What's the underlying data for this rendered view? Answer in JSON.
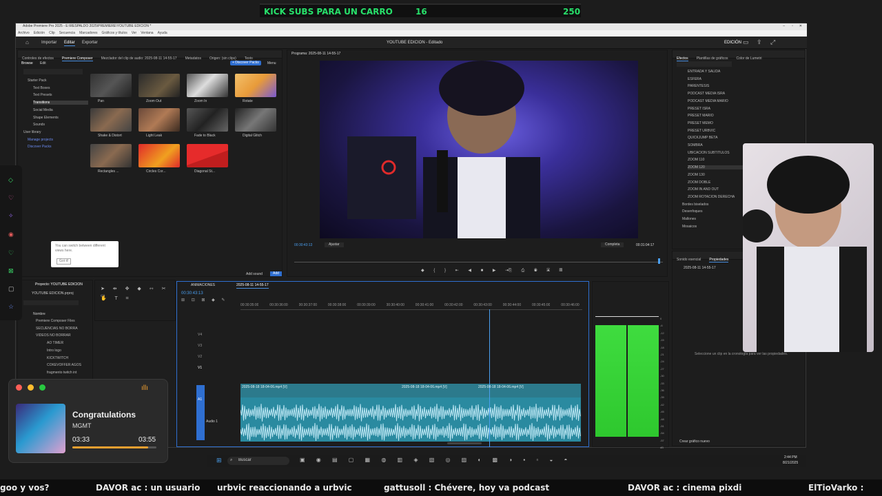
{
  "banner": {
    "text": "KICK SUBS PARA UN CARRO",
    "count": "16",
    "goal": "250"
  },
  "window": {
    "title": "Adobe Premiere Pro 2025 - E:\\RESPALDO 2025\\PREMIERE\\YOUTUBE EDICION *",
    "menu": [
      "Archivo",
      "Edición",
      "Clip",
      "Secuencia",
      "Marcadores",
      "Gráficos y títulos",
      "Ver",
      "Ventana",
      "Ayuda"
    ],
    "nav": {
      "import": "Importar",
      "edit": "Editar",
      "export": "Exportar"
    },
    "project_title": "YOUTUBE EDICION - Editado",
    "workspace": "EDICIÓN"
  },
  "effects_panel": {
    "tabs": [
      "Controles de efectos",
      "Premiere Composer",
      "Mezclador del clip de audio: 2025-08-11 14-55-17",
      "Metadatos",
      "Origen: (sin clips)",
      "Texto"
    ],
    "subtabs": [
      "Browse",
      "Edit"
    ],
    "discover": "+ Discover Packs",
    "menu": "Menu",
    "tree": [
      "Starter Pack",
      "Text Boxes",
      "Text Presets",
      "Transitions",
      "Social Media",
      "Shape Elements",
      "Sounds",
      "User library",
      "Manage projects",
      "Discover Packs"
    ],
    "thumbs": [
      "Pan",
      "Zoom Out",
      "Zoom In",
      "Rotate",
      "Shake & Distort",
      "Light Leak",
      "Fade to Black",
      "Digital Glitch",
      "Rectangles ...",
      "Circles Cor...",
      "Diagonal St..."
    ],
    "tooltip": "You can switch between different views here.",
    "tooltip_btn": "Got it!",
    "add_sound": "Add sound",
    "add": "Add"
  },
  "program": {
    "label": "Programa: 2025-08-11 14-55-17",
    "timecode": "00:30:43:13",
    "fit": "Ajustar",
    "quality": "Completa",
    "duration": "00:31:04:17"
  },
  "right_panel": {
    "tabs": [
      "Efectos",
      "Plantillas de gráficos",
      "Color de Lumetri"
    ],
    "items": [
      "ENTRADA Y SALIDA",
      "ESFERA",
      "PARENTESIS",
      "PODCAST MEDIA ISRA",
      "PODCAST MEDIA MARIO",
      "PRESET ISRA",
      "PRESET MARIO",
      "PRESET MEMO",
      "PRESET URBVIC",
      "QUICKJUMP BETA",
      "SOMBRA",
      "UBICACION SUBTITULOS",
      "ZOOM 110",
      "ZOOM 120",
      "ZOOM 130",
      "ZOOM DOBLE",
      "ZOOM IN AND OUT",
      "ZOOM ROTACION DERECHA",
      "Bordes biselados",
      "Desenfoques",
      "Mallones",
      "Mosaicos"
    ],
    "bottom_tabs": [
      "Sonido esencial",
      "Propiedades"
    ],
    "clip": "2025-08-11 14-55-17",
    "hint": "Seleccione un clip en la cronología para ver las propiedades.",
    "create": "Crear gráfico nuevo"
  },
  "project": {
    "tab": "Proyecto: YOUTUBE EDICION",
    "file": "YOUTUBE EDICION.prproj",
    "col": "Nombre",
    "items": [
      "Premiere Composer Files",
      "SECUENCIAS NO BORRA",
      "VIDEOS NO BORRAR",
      "AO TIMER",
      "Intro logo",
      "KICKTWITCH",
      "COKEVOFFER AGOS",
      "fragmento twitch int"
    ]
  },
  "timeline": {
    "tabs": [
      "ANIMACIONES",
      "2025-08-11 14-55-17"
    ],
    "timecode": "00:30:43:13",
    "ruler": [
      "00:30:35:00",
      "00:30:36:00",
      "00:30:37:00",
      "00:30:38:00",
      "00:30:39:00",
      "00:30:40:00",
      "00:30:41:00",
      "00:30:42:00",
      "00:30:43:00",
      "00:30:44:00",
      "00:30:45:00",
      "00:30:46:00"
    ],
    "tracks": [
      "V4",
      "V3",
      "V2",
      "V1",
      "A1"
    ],
    "audio_label": "Audio 1",
    "clips": [
      "2025-08-18 18-04-06.mp4 [V]",
      "2025-08-18 18-04-06.mp4 [V]",
      "2025-08-18 18-04-06.mp4 [V]"
    ]
  },
  "meter": {
    "scale": [
      "0",
      "-6",
      "-12",
      "-15",
      "-18",
      "-21",
      "-24",
      "-27",
      "-30",
      "-33",
      "-36",
      "-39",
      "-42",
      "-45",
      "-48",
      "-51",
      "-54",
      "-57",
      "dB"
    ]
  },
  "music": {
    "title": "Congratulations",
    "artist": "MGMT",
    "elapsed": "03:33",
    "total": "03:55",
    "progress": 0.9
  },
  "taskbar": {
    "search": "Buscar",
    "time": "2:44 PM",
    "date": "8/21/2025"
  },
  "chat": [
    "goo y vos?",
    "DAVOR ac : un usuario",
    "urbvic reaccionando a urbvic",
    "gattusoll : Chévere, hoy va podcast",
    "DAVOR ac : cinema pixdi",
    "ElTioVarko :"
  ]
}
